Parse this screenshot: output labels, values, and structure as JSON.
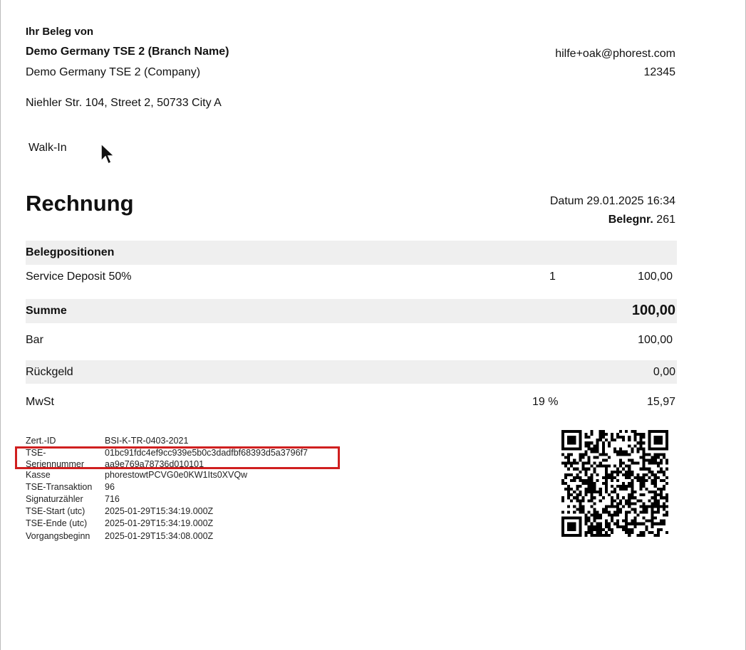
{
  "header": {
    "title_line": "Ihr Beleg von",
    "branch_name": "Demo Germany TSE 2 (Branch Name)",
    "company_name": "Demo Germany TSE 2 (Company)",
    "address": "Niehler Str. 104, Street 2, 50733 City A",
    "email": "hilfe+oak@phorest.com",
    "number": "12345"
  },
  "client": {
    "name": "Walk-In"
  },
  "invoice": {
    "title": "Rechnung",
    "date": "Datum 29.01.2025 16:34",
    "receipt_label": "Belegnr.",
    "receipt_number": "261"
  },
  "positions": {
    "header": "Belegpositionen",
    "items": [
      {
        "name": "Service Deposit 50%",
        "qty": "1",
        "amount": "100,00"
      }
    ]
  },
  "totals": {
    "sum_label": "Summe",
    "sum_value": "100,00",
    "cash_label": "Bar",
    "cash_value": "100,00",
    "change_label": "Rückgeld",
    "change_value": "0,00",
    "vat_label": "MwSt",
    "vat_rate": "19 %",
    "vat_value": "15,97"
  },
  "tse": {
    "rows": [
      {
        "label": "Zert.-ID",
        "value": "BSI-K-TR-0403-2021"
      },
      {
        "label": "TSE-",
        "value": "01bc91fdc4ef9cc939e5b0c3dadfbf68393d5a3796f7"
      },
      {
        "label": "Seriennummer",
        "value": "aa9e769a78736d010101"
      },
      {
        "label": "Kasse",
        "value": "phorestowtPCVG0e0KW1Its0XVQw"
      },
      {
        "label": "TSE-Transaktion",
        "value": "96"
      },
      {
        "label": "Signaturzähler",
        "value": "716"
      },
      {
        "label": "TSE-Start (utc)",
        "value": "2025-01-29T15:34:19.000Z"
      },
      {
        "label": "TSE-Ende (utc)",
        "value": "2025-01-29T15:34:19.000Z"
      },
      {
        "label": "Vorgangsbeginn",
        "value": "2025-01-29T15:34:08.000Z"
      }
    ]
  },
  "annotation": {
    "highlight_color": "#d01f1f"
  }
}
